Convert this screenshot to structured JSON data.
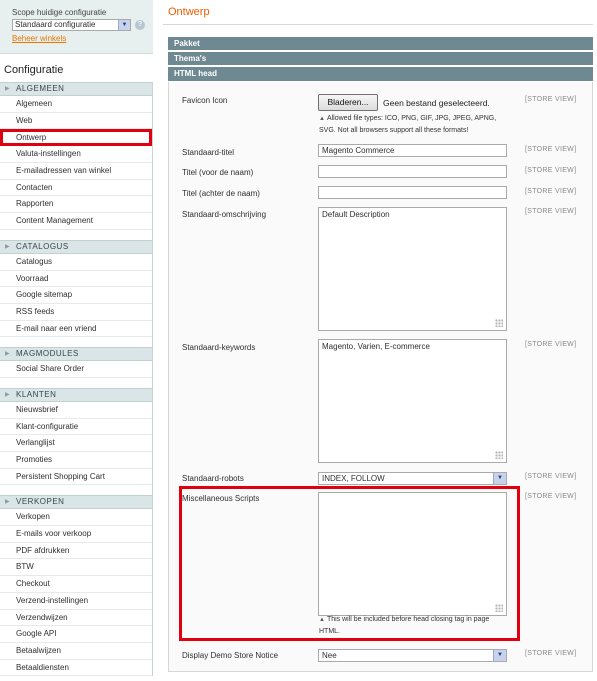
{
  "sidebar": {
    "scope_label": "Scope huidige configuratie",
    "scope_value": "Standaard configuratie",
    "scope_link": "Beheer winkels",
    "config_title": "Configuratie",
    "sections": [
      {
        "title": "ALGEMEEN",
        "items": [
          "Algemeen",
          "Web",
          "Ontwerp",
          "Valuta-instellingen",
          "E-mailadressen van winkel",
          "Contacten",
          "Rapporten",
          "Content Management"
        ]
      },
      {
        "title": "CATALOGUS",
        "items": [
          "Catalogus",
          "Voorraad",
          "Google sitemap",
          "RSS feeds",
          "E-mail naar een vriend"
        ]
      },
      {
        "title": "MAGMODULES",
        "items": [
          "Social Share Order"
        ]
      },
      {
        "title": "KLANTEN",
        "items": [
          "Nieuwsbrief",
          "Klant-configuratie",
          "Verlanglijst",
          "Promoties",
          "Persistent Shopping Cart"
        ]
      },
      {
        "title": "VERKOPEN",
        "items": [
          "Verkopen",
          "E-mails voor verkoop",
          "PDF afdrukken",
          "BTW",
          "Checkout",
          "Verzend-instellingen",
          "Verzendwijzen",
          "Google API",
          "Betaalwijzen",
          "Betaaldiensten"
        ]
      }
    ],
    "active_item": "Ontwerp"
  },
  "main": {
    "page_title": "Ontwerp",
    "bars": {
      "pakket": "Pakket",
      "themas": "Thema's",
      "html_head": "HTML head"
    },
    "scope_tag": "[STORE VIEW]",
    "fields": {
      "favicon": {
        "label": "Favicon Icon",
        "button": "Bladeren...",
        "status": "Geen bestand geselecteerd.",
        "note": "Allowed file types: ICO, PNG, GIF, JPG, JPEG, APNG, SVG. Not all browsers support all these formats!"
      },
      "default_title": {
        "label": "Standaard-titel",
        "value": "Magento Commerce"
      },
      "title_prefix": {
        "label": "Titel (voor de naam)",
        "value": ""
      },
      "title_suffix": {
        "label": "Titel (achter de naam)",
        "value": ""
      },
      "default_description": {
        "label": "Standaard-omschrijving",
        "value": "Default Description"
      },
      "default_keywords": {
        "label": "Standaard-keywords",
        "value": "Magento, Varien, E-commerce"
      },
      "default_robots": {
        "label": "Standaard-robots",
        "value": "INDEX, FOLLOW"
      },
      "misc_scripts": {
        "label": "Miscellaneous Scripts",
        "value": "",
        "note": "This will be included before head closing tag in page HTML."
      },
      "demo_notice": {
        "label": "Display Demo Store Notice",
        "value": "Nee"
      }
    }
  },
  "colors": {
    "accent_orange": "#eb5e00",
    "section_bar": "#6f8992",
    "highlight_red": "#e0000e",
    "sidebar_section_bg": "#d9e5e6"
  },
  "icons": {
    "help": "help-icon",
    "dropdown": "chevron-down-icon",
    "section_arrow": "triangle-right-icon",
    "resize": "resize-grip-icon"
  }
}
